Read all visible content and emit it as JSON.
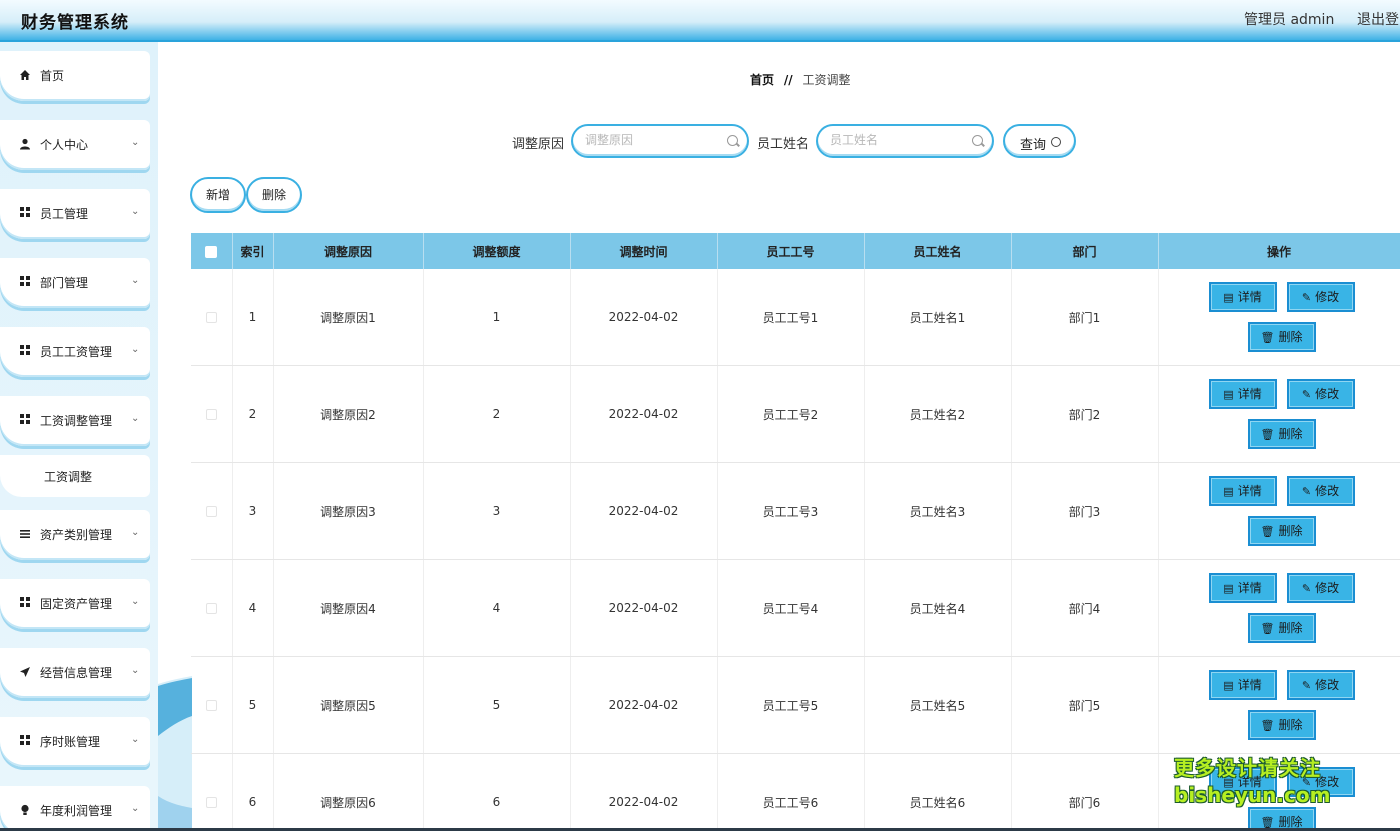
{
  "header": {
    "title": "财务管理系统",
    "user": "管理员 admin",
    "logout": "退出登"
  },
  "sidebar": {
    "items": [
      {
        "label": "首页",
        "icon": "home-icon",
        "has_arrow": false
      },
      {
        "label": "个人中心",
        "icon": "user-icon",
        "has_arrow": true
      },
      {
        "label": "员工管理",
        "icon": "grid-icon",
        "has_arrow": true
      },
      {
        "label": "部门管理",
        "icon": "grid-icon",
        "has_arrow": true
      },
      {
        "label": "员工工资管理",
        "icon": "grid-icon",
        "has_arrow": true
      },
      {
        "label": "工资调整管理",
        "icon": "grid-icon",
        "has_arrow": true
      },
      {
        "label": "资产类别管理",
        "icon": "list-icon",
        "has_arrow": true
      },
      {
        "label": "固定资产管理",
        "icon": "grid-icon",
        "has_arrow": true
      },
      {
        "label": "经营信息管理",
        "icon": "send-icon",
        "has_arrow": true
      },
      {
        "label": "序时账管理",
        "icon": "grid-icon",
        "has_arrow": true
      },
      {
        "label": "年度利润管理",
        "icon": "bulb-icon",
        "has_arrow": true
      }
    ],
    "sub_item": "工资调整"
  },
  "breadcrumb": {
    "home": "首页",
    "separator": "//",
    "current": "工资调整"
  },
  "search": {
    "reason_label": "调整原因",
    "reason_placeholder": "调整原因",
    "reason_value": "",
    "name_label": "员工姓名",
    "name_placeholder": "员工姓名",
    "name_value": "",
    "query_label": "查询"
  },
  "actions": {
    "add_label": "新增",
    "delete_label": "删除"
  },
  "table": {
    "columns": [
      "索引",
      "调整原因",
      "调整额度",
      "调整时间",
      "员工工号",
      "员工姓名",
      "部门",
      "操作"
    ],
    "rows": [
      [
        "1",
        "调整原因1",
        "1",
        "2022-04-02",
        "员工工号1",
        "员工姓名1",
        "部门1"
      ],
      [
        "2",
        "调整原因2",
        "2",
        "2022-04-02",
        "员工工号2",
        "员工姓名2",
        "部门2"
      ],
      [
        "3",
        "调整原因3",
        "3",
        "2022-04-02",
        "员工工号3",
        "员工姓名3",
        "部门3"
      ],
      [
        "4",
        "调整原因4",
        "4",
        "2022-04-02",
        "员工工号4",
        "员工姓名4",
        "部门4"
      ],
      [
        "5",
        "调整原因5",
        "5",
        "2022-04-02",
        "员工工号5",
        "员工姓名5",
        "部门5"
      ],
      [
        "6",
        "调整原因6",
        "6",
        "2022-04-02",
        "员工工号6",
        "员工姓名6",
        "部门6"
      ]
    ],
    "op_detail": "详情",
    "op_edit": "修改",
    "op_delete": "删除"
  },
  "watermark": {
    "line1": "更多设计请关注",
    "line2": "bisheyun.com"
  },
  "colors": {
    "accent": "#3ab0e2",
    "table_header": "#7cc7e8",
    "op_button": "#39b4e6"
  }
}
